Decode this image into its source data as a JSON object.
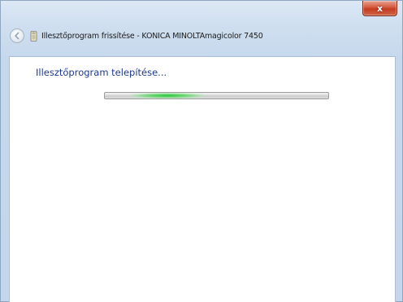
{
  "window": {
    "title": "Illesztőprogram frissítése - KONICA MINOLTAmagicolor 7450",
    "close_label": "x",
    "icon": "printer-driver-icon",
    "back_icon": "back-arrow-icon"
  },
  "content": {
    "heading": "Illesztőprogram telepítése...",
    "progress": {
      "state": "indeterminate",
      "glow_position": 0.28,
      "glow_color": "#28c83c"
    }
  },
  "colors": {
    "heading": "#1e3a8c",
    "close_button": "#c43c1f",
    "frame": "#c6d8ec"
  }
}
